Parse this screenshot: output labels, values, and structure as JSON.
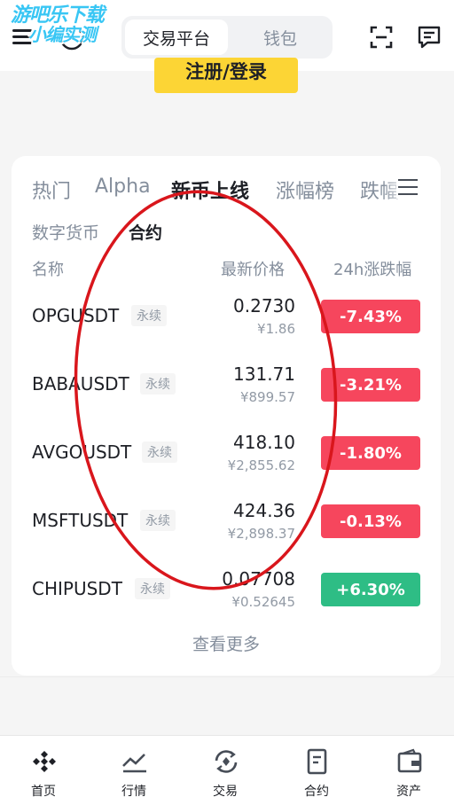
{
  "watermark": {
    "line1": "游吧乐下载",
    "line2": "小编实测"
  },
  "header": {
    "segments": [
      {
        "label": "交易平台",
        "active": true
      },
      {
        "label": "钱包",
        "active": false
      }
    ],
    "register_label": "注册/登录"
  },
  "market": {
    "tabs": [
      {
        "label": "热门",
        "active": false
      },
      {
        "label": "Alpha",
        "active": false
      },
      {
        "label": "新币上线",
        "active": true
      },
      {
        "label": "涨幅榜",
        "active": false
      },
      {
        "label": "跌幅",
        "active": false
      }
    ],
    "subtabs": [
      {
        "label": "数字货币",
        "active": false
      },
      {
        "label": "合约",
        "active": true
      }
    ],
    "columns": {
      "name": "名称",
      "price": "最新价格",
      "change": "24h涨跌幅"
    },
    "rows": [
      {
        "pair": "OPGUSDT",
        "tag": "永续",
        "price": "0.2730",
        "fiat": "¥1.86",
        "change": "-7.43%",
        "direction": "down"
      },
      {
        "pair": "BABAUSDT",
        "tag": "永续",
        "price": "131.71",
        "fiat": "¥899.57",
        "change": "-3.21%",
        "direction": "down"
      },
      {
        "pair": "AVGOUSDT",
        "tag": "永续",
        "price": "418.10",
        "fiat": "¥2,855.62",
        "change": "-1.80%",
        "direction": "down"
      },
      {
        "pair": "MSFTUSDT",
        "tag": "永续",
        "price": "424.36",
        "fiat": "¥2,898.37",
        "change": "-0.13%",
        "direction": "down"
      },
      {
        "pair": "CHIPUSDT",
        "tag": "永续",
        "price": "0.07708",
        "fiat": "¥0.52645",
        "change": "+6.30%",
        "direction": "up"
      }
    ],
    "more_label": "查看更多"
  },
  "colors": {
    "up": "#2ebd85",
    "down": "#f6465d",
    "brand": "#fcd535",
    "annotation": "#d9161c"
  },
  "bottom_nav": [
    {
      "label": "首页",
      "icon": "home-diamond-icon",
      "active": true
    },
    {
      "label": "行情",
      "icon": "market-chart-icon",
      "active": false
    },
    {
      "label": "交易",
      "icon": "trade-exchange-icon",
      "active": false
    },
    {
      "label": "合约",
      "icon": "futures-document-icon",
      "active": false
    },
    {
      "label": "资产",
      "icon": "wallet-icon",
      "active": false
    }
  ]
}
